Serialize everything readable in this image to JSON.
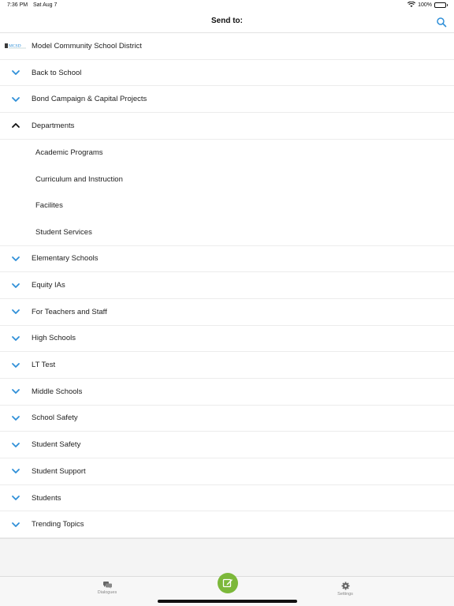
{
  "status_bar": {
    "time": "7:36 PM",
    "date": "Sat Aug 7",
    "battery": "100%"
  },
  "header": {
    "title": "Send to:"
  },
  "org": {
    "name": "Model Community School District",
    "logo_text": "MCSD"
  },
  "groups": [
    {
      "label": "Back to School",
      "expanded": false
    },
    {
      "label": "Bond Campaign & Capital Projects",
      "expanded": false
    },
    {
      "label": "Departments",
      "expanded": true,
      "children": [
        "Academic Programs",
        "Curriculum and Instruction",
        "Facilites",
        "Student Services"
      ]
    },
    {
      "label": "Elementary Schools",
      "expanded": false
    },
    {
      "label": "Equity IAs",
      "expanded": false
    },
    {
      "label": "For Teachers and Staff",
      "expanded": false
    },
    {
      "label": "High Schools",
      "expanded": false
    },
    {
      "label": "LT Test",
      "expanded": false
    },
    {
      "label": "Middle Schools",
      "expanded": false
    },
    {
      "label": "School Safety",
      "expanded": false
    },
    {
      "label": "Student Safety",
      "expanded": false
    },
    {
      "label": "Student Support",
      "expanded": false
    },
    {
      "label": "Students",
      "expanded": false
    },
    {
      "label": "Trending Topics",
      "expanded": false
    }
  ],
  "tab_bar": {
    "dialogues_label": "Dialogues",
    "settings_label": "Settings"
  },
  "colors": {
    "accent": "#2f8fd8",
    "compose": "#7cb83a"
  }
}
